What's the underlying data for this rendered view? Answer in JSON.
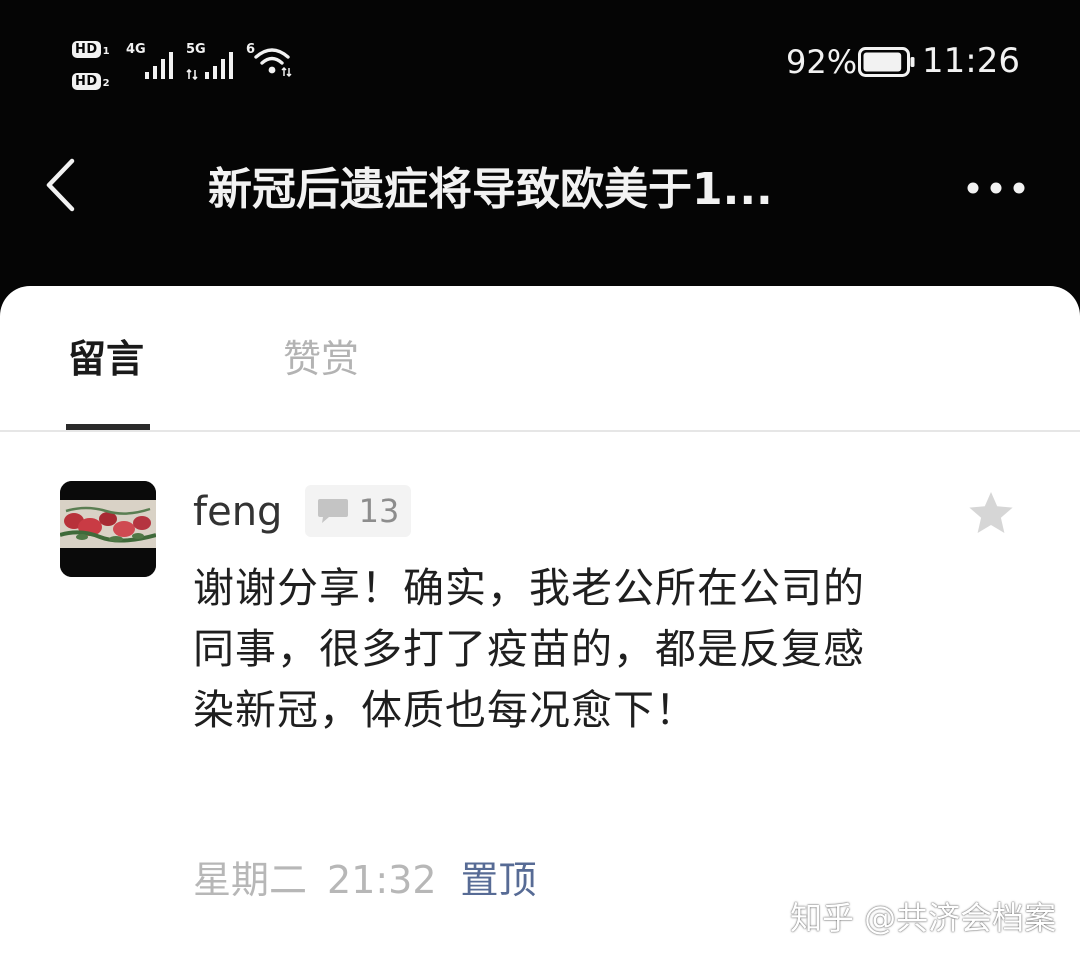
{
  "status_bar": {
    "sim1_label": "HD",
    "sim1_slot": "1",
    "sim2_label": "HD",
    "sim2_slot": "2",
    "network1": "4G",
    "network2": "5G",
    "wifi_label": "6",
    "battery_percent": "92%",
    "battery_level": 0.92,
    "time": "11:26",
    "icons": [
      "hd-icon",
      "signal-icon",
      "wifi-icon",
      "battery-icon"
    ]
  },
  "header": {
    "title": "新冠后遗症将导致欧美于1...",
    "back_icon": "chevron-left-icon",
    "more_icon": "more-horizontal-icon"
  },
  "tabs": [
    {
      "label": "留言",
      "active": true
    },
    {
      "label": "赞赏",
      "active": false
    }
  ],
  "comment": {
    "author": "feng",
    "reply_icon": "comment-bubble-icon",
    "reply_count": "13",
    "star_icon": "star-icon",
    "text": "谢谢分享！确实，我老公所在公司的同事，很多打了疫苗的，都是反复感染新冠，体质也每况愈下！",
    "day": "星期二",
    "time": "21:32",
    "pin_label": "置顶"
  },
  "watermark": "知乎 @共济会档案",
  "colors": {
    "background_dark": "#050505",
    "sheet": "#ffffff",
    "text_primary": "#1f1f1f",
    "text_muted": "#b7b7b7",
    "link": "#576b95",
    "divider": "#e6e6e6"
  }
}
